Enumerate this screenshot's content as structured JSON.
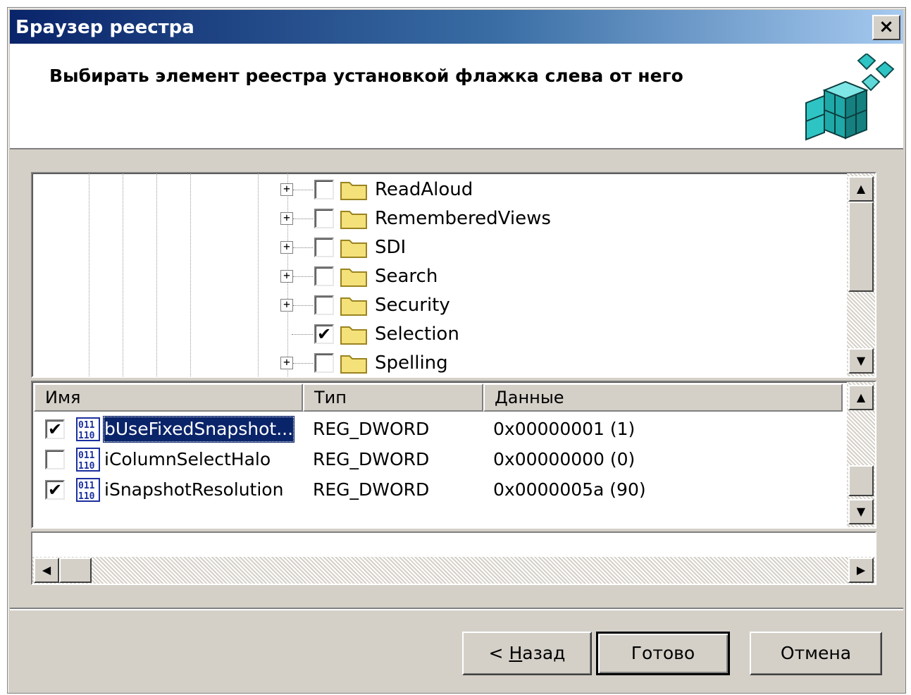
{
  "window": {
    "title": "Браузер реестра",
    "close_label": "×",
    "instruction": "Выбирать элемент реестра установкой флажка слева от него"
  },
  "tree": {
    "items": [
      {
        "label": "ReadAloud",
        "checked": false,
        "expandable": true
      },
      {
        "label": "RememberedViews",
        "checked": false,
        "expandable": true
      },
      {
        "label": "SDI",
        "checked": false,
        "expandable": true
      },
      {
        "label": "Search",
        "checked": false,
        "expandable": true
      },
      {
        "label": "Security",
        "checked": false,
        "expandable": true
      },
      {
        "label": "Selection",
        "checked": true,
        "expandable": false
      },
      {
        "label": "Spelling",
        "checked": false,
        "expandable": true
      }
    ],
    "expander_glyph": "+",
    "check_glyph": "✔"
  },
  "list": {
    "columns": [
      "Имя",
      "Тип",
      "Данные"
    ],
    "rows": [
      {
        "checked": true,
        "name": "bUseFixedSnapshot...",
        "type": "REG_DWORD",
        "data": "0x00000001 (1)",
        "selected": true
      },
      {
        "checked": false,
        "name": "iColumnSelectHalo",
        "type": "REG_DWORD",
        "data": "0x00000000 (0)",
        "selected": false
      },
      {
        "checked": true,
        "name": "iSnapshotResolution",
        "type": "REG_DWORD",
        "data": "0x0000005a (90)",
        "selected": false
      }
    ]
  },
  "scrollbar_glyphs": {
    "up": "▲",
    "down": "▼",
    "left": "◀",
    "right": "▶"
  },
  "buttons": {
    "back_prefix": "< ",
    "back_hotkey": "Н",
    "back_rest": "азад",
    "finish": "Готово",
    "cancel": "Отмена"
  },
  "colors": {
    "title_start": "#0a246a",
    "title_end": "#a6caf0",
    "face": "#d4d0c8",
    "selection": "#0a246a",
    "folder": "#f4e17a",
    "icon_teal": "#2ec4c4"
  }
}
